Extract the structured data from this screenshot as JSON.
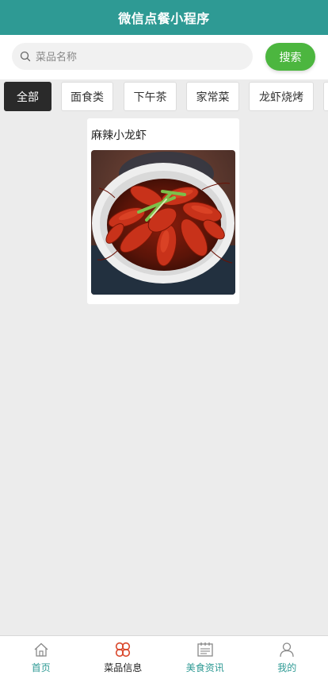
{
  "app": {
    "title": "微信点餐小程序"
  },
  "search": {
    "placeholder": "菜品名称",
    "button_label": "搜索"
  },
  "categories": [
    {
      "label": "全部",
      "active": true
    },
    {
      "label": "面食类",
      "active": false
    },
    {
      "label": "下午茶",
      "active": false
    },
    {
      "label": "家常菜",
      "active": false
    },
    {
      "label": "龙虾烧烤",
      "active": false
    },
    {
      "label": "",
      "active": false
    }
  ],
  "dishes": [
    {
      "name": "麻辣小龙虾",
      "image": "crayfish-dish-photo"
    }
  ],
  "tabbar": {
    "items": [
      {
        "label": "首页",
        "icon": "home-icon",
        "active": false
      },
      {
        "label": "菜品信息",
        "icon": "clover-icon",
        "active": true
      },
      {
        "label": "美食资讯",
        "icon": "news-icon",
        "active": false
      },
      {
        "label": "我的",
        "icon": "user-icon",
        "active": false
      }
    ]
  },
  "colors": {
    "header": "#2e9a94",
    "accent_green": "#4cb63f",
    "active_tab_icon": "#d9472b",
    "tab_inactive_text": "#2e9a94"
  }
}
